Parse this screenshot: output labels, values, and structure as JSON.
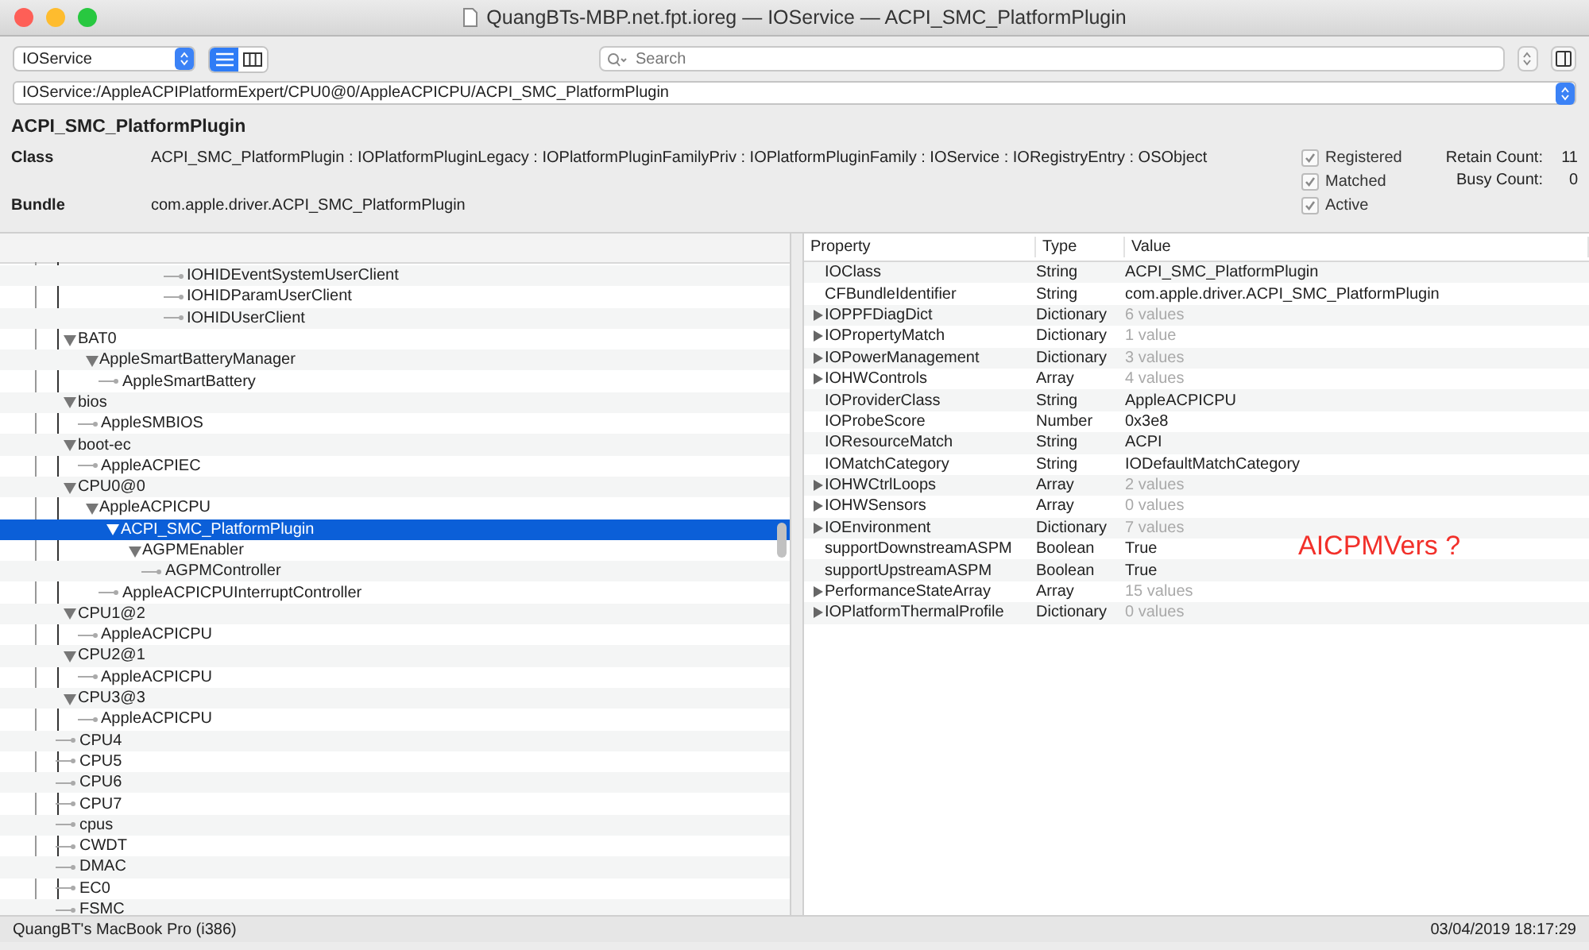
{
  "window": {
    "title": "QuangBTs-MBP.net.fpt.ioreg — IOService — ACPI_SMC_PlatformPlugin"
  },
  "toolbar": {
    "plane": "IOService",
    "views": [
      {
        "kind": "list",
        "selected": true
      },
      {
        "kind": "columns",
        "selected": false
      }
    ],
    "search": {
      "placeholder": "Search"
    }
  },
  "path": "IOService:/AppleACPIPlatformExpert/CPU0@0/AppleACPICPU/ACPI_SMC_PlatformPlugin",
  "info": {
    "name": "ACPI_SMC_PlatformPlugin",
    "class_label": "Class",
    "class_value": "ACPI_SMC_PlatformPlugin : IOPlatformPluginLegacy : IOPlatformPluginFamilyPriv : IOPlatformPluginFamily : IOService : IORegistryEntry : OSObject",
    "bundle_label": "Bundle",
    "bundle_value": "com.apple.driver.ACPI_SMC_PlatformPlugin",
    "flags": [
      {
        "label": "Registered",
        "checked": true
      },
      {
        "label": "Matched",
        "checked": true
      },
      {
        "label": "Active",
        "checked": true
      }
    ],
    "counts": [
      {
        "label": "Retain Count:",
        "value": "11"
      },
      {
        "label": "Busy Count:",
        "value": "0"
      }
    ]
  },
  "tree": {
    "leading_items": [
      {
        "name": "IOHIDEventSystemUserClient"
      },
      {
        "name": "IOHIDParamUserClient"
      },
      {
        "name": "IOHIDUserClient"
      }
    ],
    "items": [
      {
        "name": "BAT0",
        "expanded": true,
        "children": [
          {
            "name": "AppleSmartBatteryManager",
            "expanded": true,
            "children": [
              {
                "name": "AppleSmartBattery"
              }
            ]
          }
        ]
      },
      {
        "name": "bios",
        "expanded": true,
        "children": [
          {
            "name": "AppleSMBIOS"
          }
        ]
      },
      {
        "name": "boot-ec",
        "expanded": true,
        "children": [
          {
            "name": "AppleACPIEC"
          }
        ]
      },
      {
        "name": "CPU0@0",
        "expanded": true,
        "children": [
          {
            "name": "AppleACPICPU",
            "expanded": true,
            "children": [
              {
                "name": "ACPI_SMC_PlatformPlugin",
                "expanded": true,
                "selected": true,
                "children": [
                  {
                    "name": "AGPMEnabler",
                    "expanded": true,
                    "children": [
                      {
                        "name": "AGPMController"
                      }
                    ]
                  }
                ]
              },
              {
                "name": "AppleACPICPUInterruptController"
              }
            ]
          }
        ]
      },
      {
        "name": "CPU1@2",
        "expanded": true,
        "children": [
          {
            "name": "AppleACPICPU"
          }
        ]
      },
      {
        "name": "CPU2@1",
        "expanded": true,
        "children": [
          {
            "name": "AppleACPICPU"
          }
        ]
      },
      {
        "name": "CPU3@3",
        "expanded": true,
        "children": [
          {
            "name": "AppleACPICPU"
          }
        ]
      },
      {
        "name": "CPU4"
      },
      {
        "name": "CPU5"
      },
      {
        "name": "CPU6"
      },
      {
        "name": "CPU7"
      },
      {
        "name": "cpus"
      },
      {
        "name": "CWDT"
      },
      {
        "name": "DMAC"
      },
      {
        "name": "EC0"
      },
      {
        "name": "FSMC"
      }
    ]
  },
  "properties": {
    "columns": [
      "Property",
      "Type",
      "Value"
    ],
    "rows": [
      {
        "property": "IOClass",
        "type": "String",
        "value": "ACPI_SMC_PlatformPlugin",
        "expandable": false
      },
      {
        "property": "CFBundleIdentifier",
        "type": "String",
        "value": "com.apple.driver.ACPI_SMC_PlatformPlugin",
        "expandable": false
      },
      {
        "property": "IOPPFDiagDict",
        "type": "Dictionary",
        "value": "6 values",
        "expandable": true
      },
      {
        "property": "IOPropertyMatch",
        "type": "Dictionary",
        "value": "1 value",
        "expandable": true
      },
      {
        "property": "IOPowerManagement",
        "type": "Dictionary",
        "value": "3 values",
        "expandable": true
      },
      {
        "property": "IOHWControls",
        "type": "Array",
        "value": "4 values",
        "expandable": true
      },
      {
        "property": "IOProviderClass",
        "type": "String",
        "value": "AppleACPICPU",
        "expandable": false
      },
      {
        "property": "IOProbeScore",
        "type": "Number",
        "value": "0x3e8",
        "expandable": false
      },
      {
        "property": "IOResourceMatch",
        "type": "String",
        "value": "ACPI",
        "expandable": false
      },
      {
        "property": "IOMatchCategory",
        "type": "String",
        "value": "IODefaultMatchCategory",
        "expandable": false
      },
      {
        "property": "IOHWCtrlLoops",
        "type": "Array",
        "value": "2 values",
        "expandable": true
      },
      {
        "property": "IOHWSensors",
        "type": "Array",
        "value": "0 values",
        "expandable": true
      },
      {
        "property": "IOEnvironment",
        "type": "Dictionary",
        "value": "7 values",
        "expandable": true
      },
      {
        "property": "supportDownstreamASPM",
        "type": "Boolean",
        "value": "True",
        "expandable": false
      },
      {
        "property": "supportUpstreamASPM",
        "type": "Boolean",
        "value": "True",
        "expandable": false
      },
      {
        "property": "PerformanceStateArray",
        "type": "Array",
        "value": "15 values",
        "expandable": true
      },
      {
        "property": "IOPlatformThermalProfile",
        "type": "Dictionary",
        "value": "0 values",
        "expandable": true
      }
    ],
    "annotation": "AICPMVers ?"
  },
  "status_bar": {
    "machine": "QuangBT's MacBook Pro (i386)",
    "timestamp": "03/04/2019 18:17:29"
  }
}
